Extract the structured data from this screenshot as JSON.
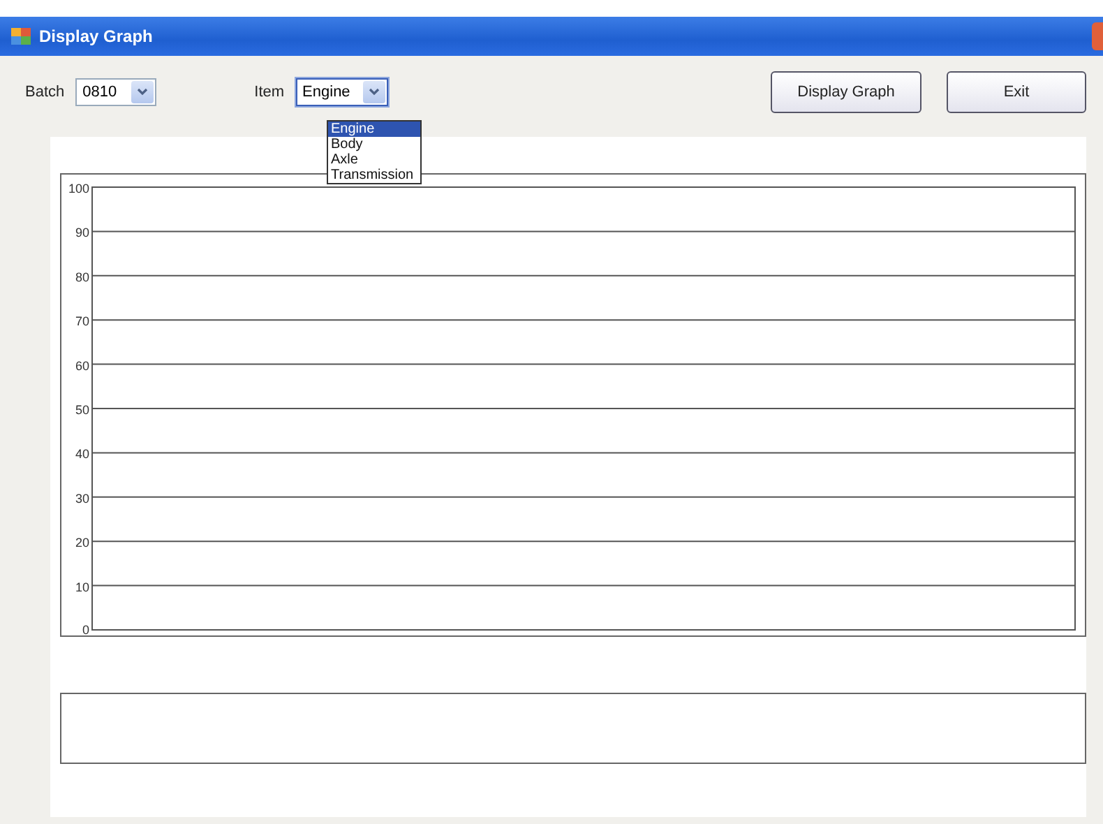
{
  "window": {
    "title": "Display Graph"
  },
  "filters": {
    "batch": {
      "label": "Batch",
      "value": "0810"
    },
    "item": {
      "label": "Item",
      "value": "Engine",
      "expanded": true,
      "options": [
        {
          "label": "Engine",
          "selected": true
        },
        {
          "label": "Body",
          "selected": false
        },
        {
          "label": "Axle",
          "selected": false
        },
        {
          "label": "Transmission",
          "selected": false
        }
      ]
    }
  },
  "buttons": [
    "Display Graph",
    "Exit"
  ],
  "graph": {
    "y_axis_labels": [
      "100",
      "90",
      "80",
      "70",
      "60",
      "50",
      "40",
      "30",
      "20",
      "10",
      "0"
    ]
  }
}
